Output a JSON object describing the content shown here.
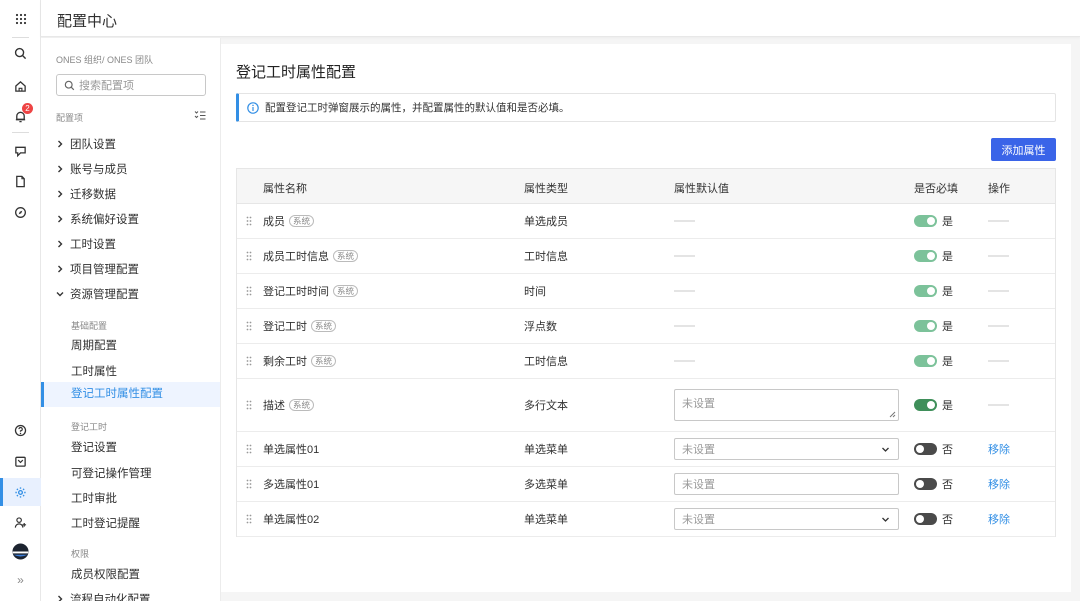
{
  "header": {
    "title": "配置中心"
  },
  "rail": {
    "icons": [
      "apps-icon",
      "search-icon",
      "home-icon",
      "notification-icon",
      "project-icon",
      "document-icon",
      "compass-icon",
      "help-icon",
      "inbox-icon",
      "settings-icon",
      "add-user-icon",
      "avatar",
      "expand-icon"
    ],
    "notification_count": "2",
    "accent": "#338fe5"
  },
  "nav": {
    "breadcrumb": "ONES 组织/ ONES 团队",
    "search_placeholder": "搜索配置项",
    "section_label": "配置项",
    "items": [
      {
        "label": "团队设置"
      },
      {
        "label": "账号与成员"
      },
      {
        "label": "迁移数据"
      },
      {
        "label": "系统偏好设置"
      },
      {
        "label": "工时设置"
      },
      {
        "label": "项目管理配置"
      },
      {
        "label": "资源管理配置"
      }
    ],
    "groups": [
      {
        "title": "基础配置",
        "items": [
          "周期配置",
          "工时属性",
          "登记工时属性配置"
        ]
      },
      {
        "title": "登记工时",
        "items": [
          "登记设置",
          "可登记操作管理",
          "工时审批",
          "工时登记提醒"
        ]
      },
      {
        "title": "权限",
        "items": [
          "成员权限配置"
        ]
      }
    ],
    "last_item": "流程自动化配置",
    "active_item": "登记工时属性配置"
  },
  "main": {
    "title": "登记工时属性配置",
    "tip": "配置登记工时弹窗展示的属性，并配置属性的默认值和是否必填。",
    "add_button": "添加属性",
    "columns": [
      "属性名称",
      "属性类型",
      "属性默认值",
      "是否必填",
      "操作"
    ],
    "system_tag": "系统",
    "rows": [
      {
        "name": "成员",
        "system": true,
        "type": "单选成员",
        "default": "",
        "required": "是",
        "op": ""
      },
      {
        "name": "成员工时信息",
        "system": true,
        "type": "工时信息",
        "default": "",
        "required": "是",
        "op": ""
      },
      {
        "name": "登记工时时间",
        "system": true,
        "type": "时间",
        "default": "",
        "required": "是",
        "op": ""
      },
      {
        "name": "登记工时",
        "system": true,
        "type": "浮点数",
        "default": "",
        "required": "是",
        "op": ""
      },
      {
        "name": "剩余工时",
        "system": true,
        "type": "工时信息",
        "default": "",
        "required": "是",
        "op": ""
      },
      {
        "name": "描述",
        "system": true,
        "type": "多行文本",
        "default": "未设置",
        "required": "是",
        "op": ""
      },
      {
        "name": "单选属性01",
        "system": false,
        "type": "单选菜单",
        "default": "未设置",
        "required": "否",
        "op": "移除"
      },
      {
        "name": "多选属性01",
        "system": false,
        "type": "多选菜单",
        "default": "未设置",
        "required": "否",
        "op": "移除"
      },
      {
        "name": "单选属性02",
        "system": false,
        "type": "单选菜单",
        "default": "未设置",
        "required": "否",
        "op": "移除"
      }
    ]
  }
}
